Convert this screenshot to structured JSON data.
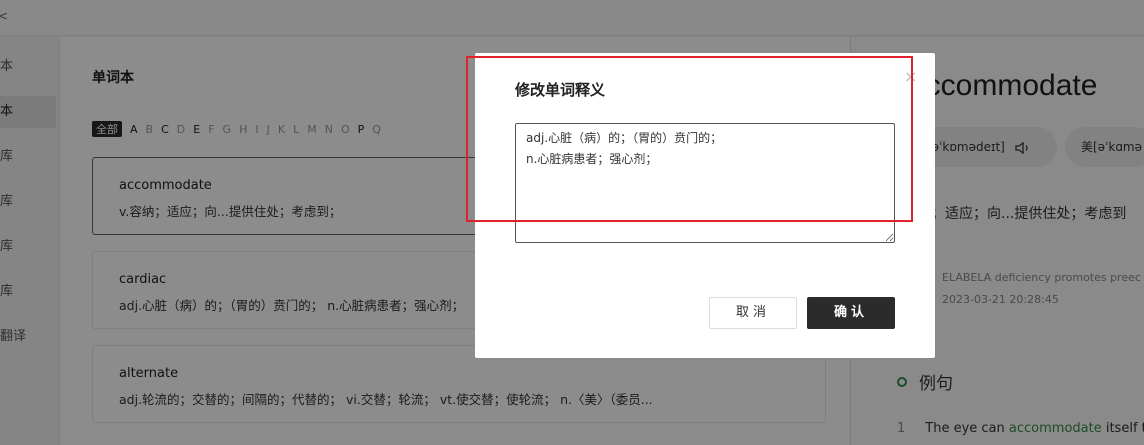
{
  "topbar": {
    "back_glyph": "<"
  },
  "sidebar": {
    "items": [
      {
        "label": "本"
      },
      {
        "label": "本"
      },
      {
        "label": "库"
      },
      {
        "label": "库"
      },
      {
        "label": "库"
      },
      {
        "label": "库"
      },
      {
        "label": "翻译"
      }
    ]
  },
  "main": {
    "title": "单词本",
    "letters": [
      "全部",
      "A",
      "B",
      "C",
      "D",
      "E",
      "F",
      "G",
      "H",
      "I",
      "J",
      "K",
      "L",
      "M",
      "N",
      "O",
      "P",
      "Q"
    ],
    "cards": [
      {
        "word": "accommodate",
        "meaning": "v.容纳；适应；向...提供住处；考虑到；"
      },
      {
        "word": "cardiac",
        "meaning": "adj.心脏（病）的；（胃的）贲门的；  n.心脏病患者；强心剂；"
      },
      {
        "word": "alternate",
        "meaning": "adj.轮流的；交替的；间隔的；代替的；  vi.交替；轮流；  vt.使交替；使轮流；  n.〈美〉（委员..."
      }
    ]
  },
  "right_panel": {
    "word": "accommodate",
    "phonetic_uk": "[əˈkɒmədeɪt]",
    "phonetic_us": "美[əˈkɑmə",
    "definition": "；适应；向...提供住处；考虑到",
    "source": "：ELABELA deficiency promotes preec",
    "time": "：2023-03-21 20:28:45",
    "examples_title": "例句",
    "example": {
      "num": "1",
      "before": "The eye can ",
      "highlight": "accommodate",
      "after": " itself to"
    }
  },
  "modal": {
    "title": "修改单词释义",
    "close_glyph": "×",
    "textarea_value": "adj.心脏（病）的；（胃的）贲门的；\nn.心脏病患者；强心剂；",
    "cancel_label": "取消",
    "ok_label": "确认"
  },
  "colors": {
    "accent_green": "#3a8a4a",
    "annotation_red": "#e0232b",
    "button_dark": "#2b2b2b"
  }
}
